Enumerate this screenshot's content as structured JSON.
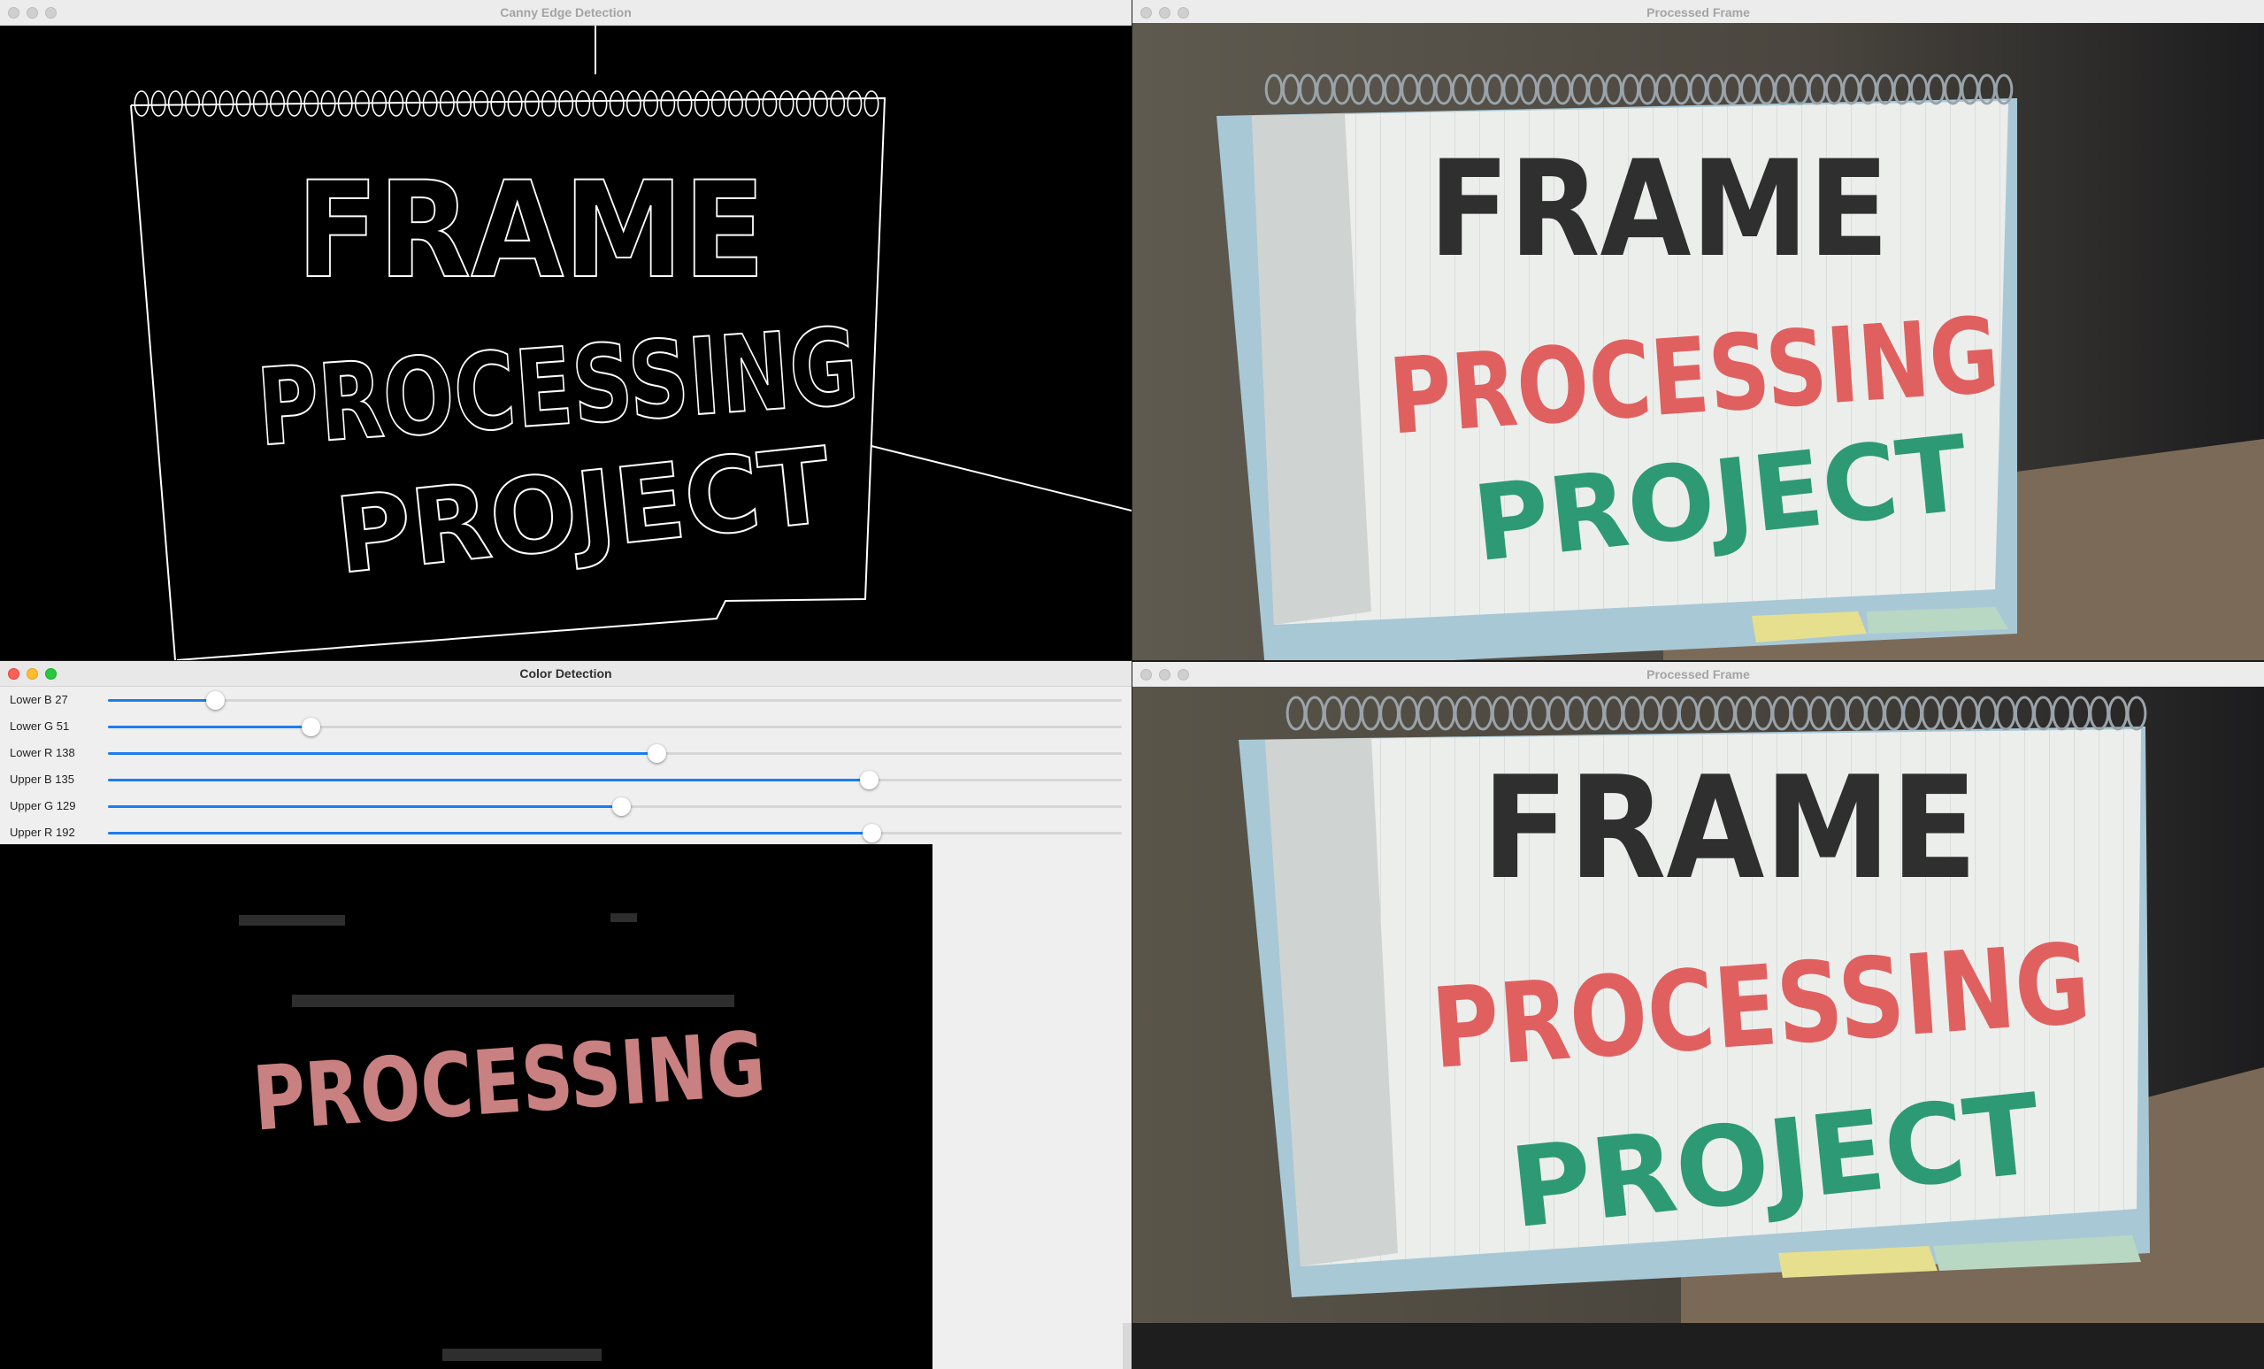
{
  "windows": {
    "canny": {
      "title": "Canny Edge Detection"
    },
    "processed_top": {
      "title": "Processed Frame"
    },
    "color_detection": {
      "title": "Color Detection",
      "sliders": [
        {
          "label": "Lower B 27",
          "value": 27,
          "max": 255
        },
        {
          "label": "Lower G 51",
          "value": 51,
          "max": 255
        },
        {
          "label": "Lower R 138",
          "value": 138,
          "max": 255
        },
        {
          "label": "Upper B 135",
          "value": 135,
          "max": 180
        },
        {
          "label": "Upper G 129",
          "value": 129,
          "max": 255
        },
        {
          "label": "Upper R 192",
          "value": 192,
          "max": 255
        }
      ]
    },
    "processed_bottom": {
      "title": "Processed Frame"
    }
  },
  "notebook_text": {
    "line1": "FRAME",
    "line2": "PROCESSING",
    "line3": "PROJECT",
    "mask_text": "PROCESSING"
  },
  "colors": {
    "slider_fill": "#1a7df2",
    "ink_black": "#2f2f2f",
    "ink_red": "#e06060",
    "ink_green": "#2e9a75",
    "mask_pink": "#c98080"
  }
}
